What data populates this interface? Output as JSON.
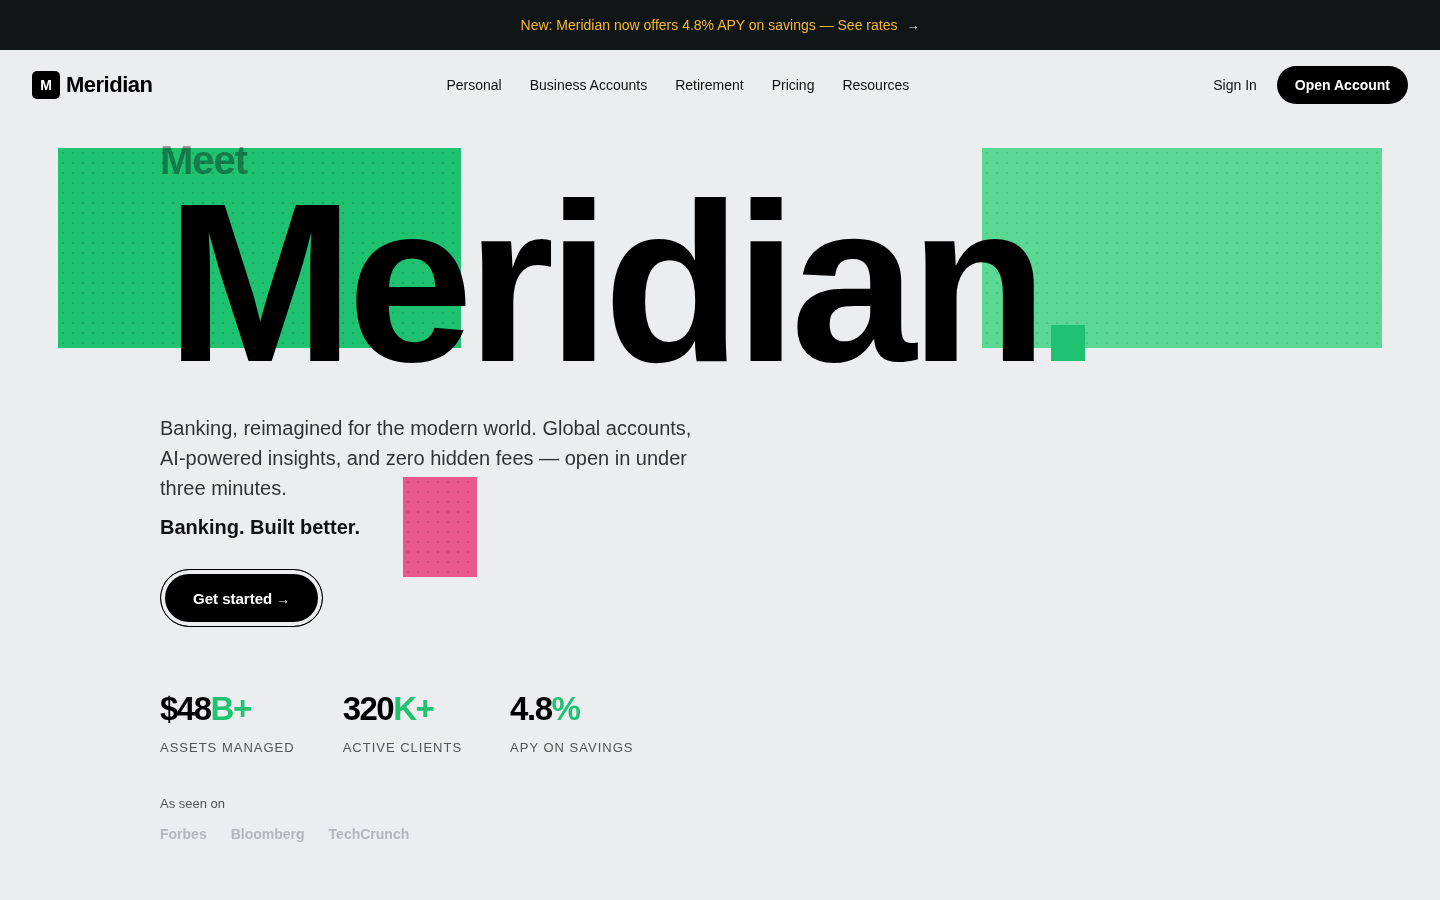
{
  "announcement": {
    "text": "New: Meridian now offers 4.8% APY on savings — See rates",
    "arrow": "→"
  },
  "header": {
    "logo_mark": "M",
    "brand": "Meridian",
    "nav": [
      "Personal",
      "Business Accounts",
      "Retirement",
      "Pricing",
      "Resources"
    ],
    "sign_in": "Sign In",
    "cta": "Open Account"
  },
  "hero": {
    "eyebrow": "Meet",
    "title": "Meridian",
    "description": "Banking, reimagined for the modern world. Global accounts, AI-powered insights, and zero hidden fees — open in under three minutes.",
    "tagline": "Banking. Built better.",
    "cta": {
      "label": "Get started",
      "arrow": "→"
    },
    "stats": [
      {
        "value": "$48",
        "suffix": "B+",
        "label": "ASSETS MANAGED"
      },
      {
        "value": "320",
        "suffix": "K+",
        "label": "ACTIVE CLIENTS"
      },
      {
        "value": "4.8",
        "suffix": "%",
        "label": "APY ON SAVINGS"
      }
    ],
    "press": {
      "label": "As seen on",
      "outlets": [
        "Forbes",
        "Bloomberg",
        "TechCrunch"
      ]
    }
  }
}
